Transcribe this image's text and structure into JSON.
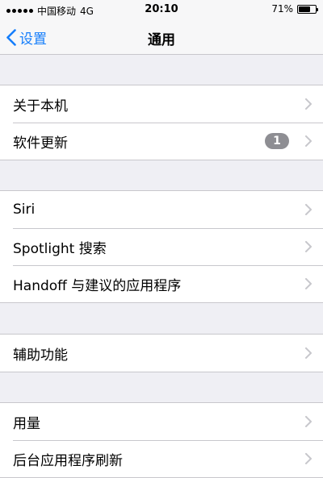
{
  "status_bar": {
    "carrier": "中国移动",
    "network": "4G",
    "time": "20:10",
    "battery_percent": "71%",
    "battery_level": 0.71,
    "signal_strength": 5
  },
  "nav": {
    "back_label": "设置",
    "title": "通用"
  },
  "groups": [
    {
      "rows": [
        {
          "label": "关于本机"
        },
        {
          "label": "软件更新",
          "badge": "1"
        }
      ]
    },
    {
      "rows": [
        {
          "label": "Siri"
        },
        {
          "label": "Spotlight 搜索"
        },
        {
          "label": "Handoff 与建议的应用程序"
        }
      ]
    },
    {
      "rows": [
        {
          "label": "辅助功能"
        }
      ]
    },
    {
      "rows": [
        {
          "label": "用量"
        },
        {
          "label": "后台应用程序刷新"
        }
      ]
    }
  ],
  "colors": {
    "accent": "#157efb",
    "background": "#efeff4",
    "separator": "#c8c7cc",
    "badge": "#8e8e93",
    "chevron": "#c7c7cc"
  }
}
